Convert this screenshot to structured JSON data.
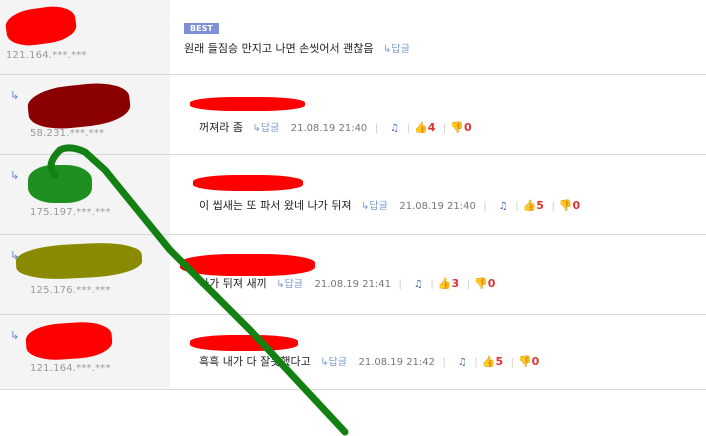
{
  "best_badge": "BEST",
  "reply_label": "↳답글",
  "comments": [
    {
      "ip": "121.164.***.***",
      "text": "원래 들짐승 만지고 나면 손씻어서 괜찮음",
      "date": "",
      "up": "",
      "down": "",
      "best": true
    },
    {
      "ip": "58.231.***.***",
      "text": "꺼져라 좀",
      "date": "21.08.19 21:40",
      "up": "4",
      "down": "0"
    },
    {
      "ip": "175.197.***.***",
      "text": "이 씹새는 또 파서 왔네 나가 뒤져",
      "date": "21.08.19 21:40",
      "up": "5",
      "down": "0"
    },
    {
      "ip": "125.176.***.***",
      "text": "나가 뒤져 새끼",
      "date": "21.08.19 21:41",
      "up": "3",
      "down": "0"
    },
    {
      "ip": "121.164.***.***",
      "text": "흑흑 내가 다 잘못했다고",
      "date": "21.08.19 21:42",
      "up": "5",
      "down": "0"
    }
  ],
  "colors": {
    "redact_red": "#ff0000",
    "redact_dark": "#8b0000",
    "redact_green": "#1f8f1f",
    "redact_olive": "#8a8a00",
    "scribble_green": "#138013",
    "best_badge_bg": "#7d8fd6"
  },
  "icons": [
    "reply-arrow-icon",
    "bell-icon",
    "thumbs-up-icon",
    "thumbs-down-icon"
  ]
}
